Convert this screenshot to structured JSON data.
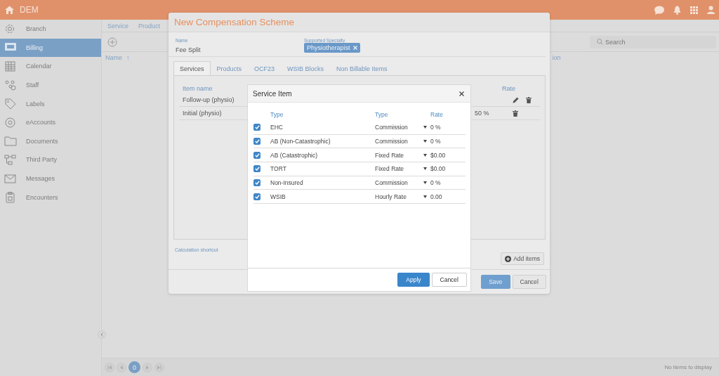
{
  "header": {
    "title": "DEM"
  },
  "sidebar": {
    "items": [
      {
        "label": "Branch",
        "selected": false
      },
      {
        "label": "Billing",
        "selected": true
      },
      {
        "label": "Calendar",
        "selected": false
      },
      {
        "label": "Staff",
        "selected": false
      },
      {
        "label": "Labels",
        "selected": false
      },
      {
        "label": "eAccounts",
        "selected": false
      },
      {
        "label": "Documents",
        "selected": false
      },
      {
        "label": "Third Party",
        "selected": false
      },
      {
        "label": "Messages",
        "selected": false
      },
      {
        "label": "Encounters",
        "selected": false
      }
    ]
  },
  "page": {
    "tabs": [
      "Service",
      "Product"
    ],
    "search": {
      "placeholder": "Search"
    },
    "table": {
      "columns": [
        {
          "label": "Name",
          "sort": "↑"
        },
        {
          "label": "ion"
        }
      ]
    },
    "pager": {
      "pages": [
        {
          "label": "0",
          "selected": true
        }
      ],
      "status": "No items to display"
    }
  },
  "dialog": {
    "title": "New Compensation Scheme",
    "name": {
      "label": "Name",
      "value": "Fee Split"
    },
    "specialty": {
      "label": "Supported Specialty",
      "chips": [
        "Physiotherapist"
      ]
    },
    "tabs": [
      {
        "label": "Services",
        "selected": true
      },
      {
        "label": "Products",
        "selected": false
      },
      {
        "label": "OCF23",
        "selected": false
      },
      {
        "label": "WSIB Blocks",
        "selected": false
      },
      {
        "label": "Non Billable Items",
        "selected": false
      }
    ],
    "table": {
      "columns": [
        "Item name",
        "Rate"
      ],
      "rows": [
        {
          "name": "Follow-up (physio)",
          "editable": true
        },
        {
          "name": "Initial (physio)",
          "rate": "50 %",
          "editable": false
        }
      ]
    },
    "link": "Calculation shortcut",
    "add_button": "Add items",
    "buttons": [
      {
        "label": "Save",
        "kind": "primary"
      },
      {
        "label": "Cancel",
        "kind": "default"
      }
    ]
  },
  "modal": {
    "title": "Service Item",
    "columns": [
      "Type",
      "Type",
      "Rate"
    ],
    "rows": [
      {
        "checked": true,
        "type": "EHC",
        "rate_type": "Commission",
        "rate": "0 %"
      },
      {
        "checked": true,
        "type": "AB (Non-Catastrophic)",
        "rate_type": "Commission",
        "rate": "0 %"
      },
      {
        "checked": true,
        "type": "AB (Catastrophic)",
        "rate_type": "Fixed Rate",
        "rate": "$0.00"
      },
      {
        "checked": true,
        "type": "TORT",
        "rate_type": "Fixed Rate",
        "rate": "$0.00"
      },
      {
        "checked": true,
        "type": "Non-Insured",
        "rate_type": "Commission",
        "rate": "0 %"
      },
      {
        "checked": true,
        "type": "WSIB",
        "rate_type": "Hourly Rate",
        "rate": "0.00"
      }
    ],
    "buttons": [
      {
        "label": "Apply",
        "kind": "primary"
      },
      {
        "label": "Cancel",
        "kind": "default"
      }
    ]
  }
}
